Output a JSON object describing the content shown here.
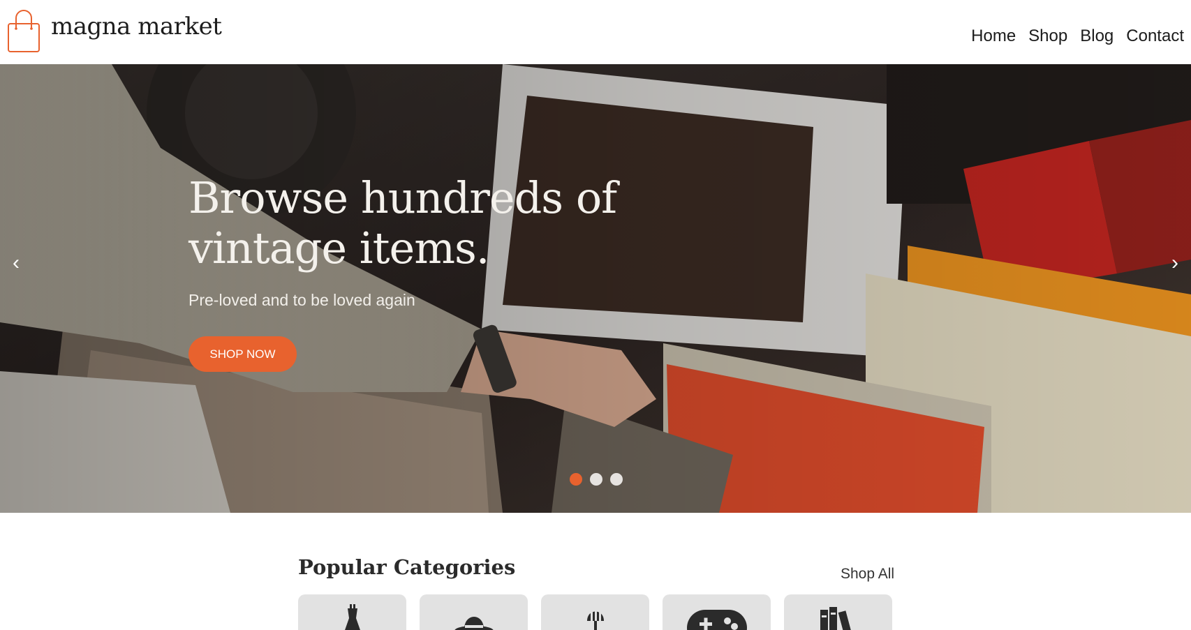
{
  "header": {
    "brand": "magna market",
    "nav": [
      "Home",
      "Shop",
      "Blog",
      "Contact"
    ]
  },
  "hero": {
    "title": "Browse hundreds of vintage items.",
    "subtitle": "Pre-loved and to be loved again",
    "cta": "SHOP NOW",
    "prev_arrow": "‹",
    "next_arrow": "›",
    "slides_count": 3,
    "active_slide": 1
  },
  "categories": {
    "title": "Popular Categories",
    "shop_all": "Shop All",
    "icons": [
      "dress-icon",
      "hat-icon",
      "lamp-icon",
      "gamepad-icon",
      "books-icon"
    ]
  },
  "colors": {
    "accent": "#e8622e",
    "card_bg": "#e2e2e2",
    "dot_inactive": "#e6e3e0"
  }
}
